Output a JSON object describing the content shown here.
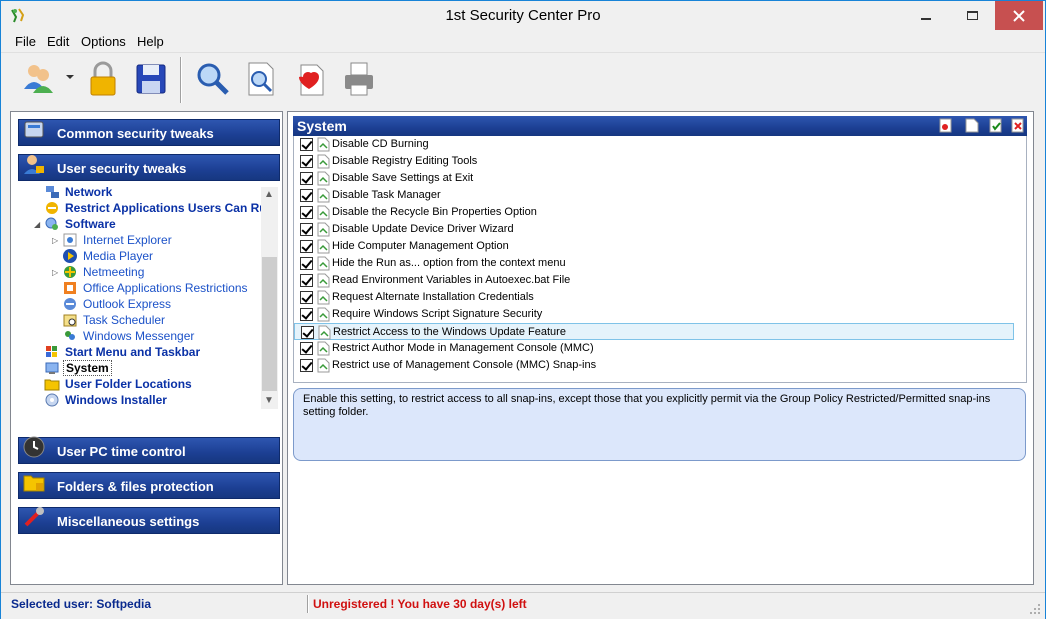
{
  "window": {
    "title": "1st Security Center Pro"
  },
  "menu": {
    "items": [
      "File",
      "Edit",
      "Options",
      "Help"
    ]
  },
  "toolbar": {
    "buttons": [
      "users-icon",
      "lock-icon",
      "save-icon",
      "search-icon",
      "find-icon",
      "heart-icon",
      "print-icon"
    ]
  },
  "left_panel": {
    "categories": [
      {
        "label": "Common security tweaks",
        "icon": "tweaks-icon"
      },
      {
        "label": "User security tweaks",
        "icon": "user-lock-icon"
      },
      {
        "label": "User PC time control",
        "icon": "clock-icon"
      },
      {
        "label": "Folders & files protection",
        "icon": "folder-lock-icon"
      },
      {
        "label": "Miscellaneous settings",
        "icon": "tools-icon"
      }
    ],
    "tree": [
      {
        "label": "Network",
        "level": 0,
        "bold": true
      },
      {
        "label": "Restrict Applications Users Can Ru",
        "level": 0,
        "bold": true
      },
      {
        "label": "Software",
        "level": 0,
        "bold": true,
        "expanded": true
      },
      {
        "label": "Internet Explorer",
        "level": 1
      },
      {
        "label": "Media Player",
        "level": 1
      },
      {
        "label": "Netmeeting",
        "level": 1
      },
      {
        "label": "Office Applications Restrictions",
        "level": 1
      },
      {
        "label": "Outlook Express",
        "level": 1
      },
      {
        "label": "Task Scheduler",
        "level": 1
      },
      {
        "label": "Windows Messenger",
        "level": 1
      },
      {
        "label": "Start Menu and Taskbar",
        "level": 0,
        "bold": true
      },
      {
        "label": "System",
        "level": 0,
        "bold": true,
        "selected": true
      },
      {
        "label": "User Folder Locations",
        "level": 0,
        "bold": true
      },
      {
        "label": "Windows Installer",
        "level": 0,
        "bold": true
      }
    ]
  },
  "right_panel": {
    "title": "System",
    "header_icons": [
      "export-icon",
      "new-icon",
      "check-icon",
      "clear-icon"
    ],
    "options": [
      {
        "label": "Disable CD Burning",
        "checked": true
      },
      {
        "label": "Disable Registry Editing Tools",
        "checked": true
      },
      {
        "label": "Disable Save Settings at Exit",
        "checked": true
      },
      {
        "label": "Disable Task Manager",
        "checked": true
      },
      {
        "label": "Disable the Recycle Bin Properties Option",
        "checked": true
      },
      {
        "label": "Disable Update Device Driver Wizard",
        "checked": true
      },
      {
        "label": "Hide Computer Management Option",
        "checked": true
      },
      {
        "label": "Hide the Run as... option from the context menu",
        "checked": true
      },
      {
        "label": "Read Environment Variables in Autoexec.bat File",
        "checked": true
      },
      {
        "label": "Request Alternate Installation Credentials",
        "checked": true
      },
      {
        "label": "Require Windows Script Signature Security",
        "checked": true
      },
      {
        "label": "Restrict Access to the Windows Update Feature",
        "checked": true,
        "highlighted": true
      },
      {
        "label": "Restrict Author Mode in Management Console (MMC)",
        "checked": true
      },
      {
        "label": "Restrict use of Management Console (MMC) Snap-ins",
        "checked": true
      }
    ],
    "description": "Enable this setting, to restrict access to all snap-ins, except those that you explicitly permit via the Group Policy Restricted/Permitted snap-ins setting folder."
  },
  "status": {
    "user": "Selected user: Softpedia",
    "registration": "Unregistered ! You have 30 day(s) left"
  },
  "colors": {
    "header_blue": "#1c3f93",
    "tree_bold": "#0a31a6",
    "status_red": "#d01010",
    "desc_bg": "#dce7fb"
  }
}
